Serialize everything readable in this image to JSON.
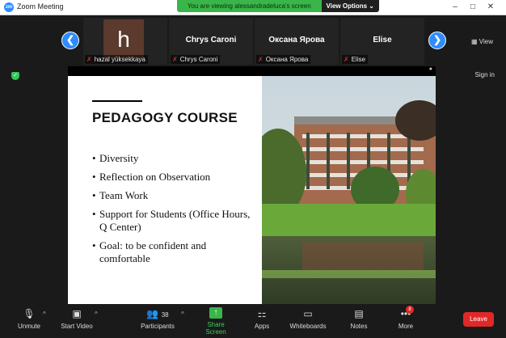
{
  "window": {
    "title": "Zoom Meeting",
    "app_icon": "zm"
  },
  "share_banner": {
    "text": "You are viewing alessandradeluca's screen",
    "view_options": "View Options"
  },
  "window_controls": {
    "minimize": "–",
    "maximize": "□",
    "close": "✕"
  },
  "gallery": {
    "prev_arrow": "❮",
    "next_arrow": "❯",
    "view_label": "View",
    "tiles": [
      {
        "avatar_letter": "h",
        "display_name": "",
        "label": "hazal yüksekkaya",
        "muted": true
      },
      {
        "avatar_letter": "",
        "display_name": "Chrys Caroni",
        "label": "Chrys Caroni",
        "muted": true
      },
      {
        "avatar_letter": "",
        "display_name": "Оксана Ярова",
        "label": "Оксана Ярова",
        "muted": true
      },
      {
        "avatar_letter": "",
        "display_name": "Elise",
        "label": "Elise",
        "muted": true
      }
    ]
  },
  "sign_in": "Sign in",
  "shared_screen": {
    "slide_title": "PEDAGOGY COURSE",
    "bullets": [
      "Diversity",
      "Reflection on Observation",
      "Team Work",
      "Support for Students (Office Hours, Q Center)",
      "Goal: to be confident and comfortable"
    ]
  },
  "toolbar": {
    "unmute": "Unmute",
    "start_video": "Start Video",
    "participants": "Participants",
    "participants_count": "38",
    "share_screen": "Share Screen",
    "apps": "Apps",
    "whiteboards": "Whiteboards",
    "notes": "Notes",
    "more": "More",
    "more_badge": "8",
    "leave": "Leave"
  },
  "colors": {
    "accent_blue": "#2d8cff",
    "share_green": "#39b54a",
    "leave_red": "#e02828"
  }
}
